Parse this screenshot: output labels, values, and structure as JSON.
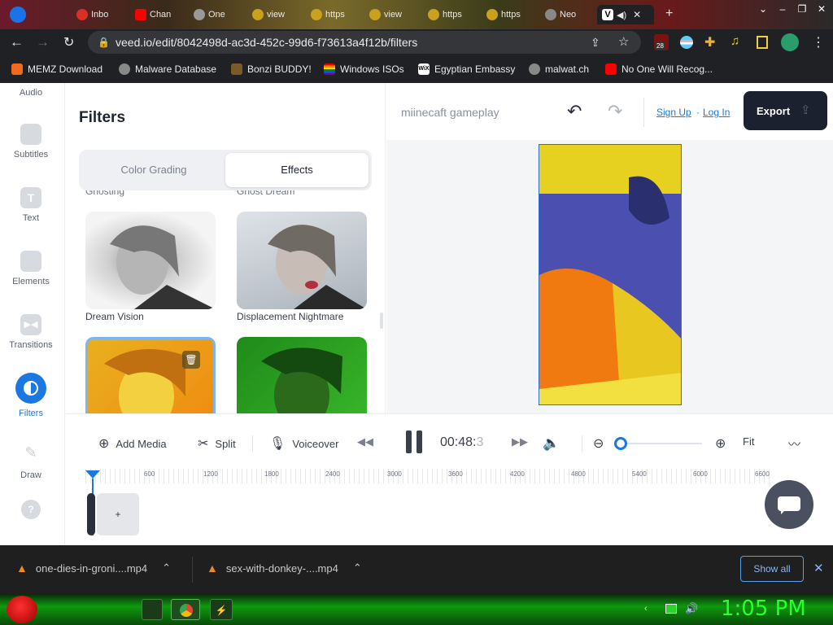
{
  "browser": {
    "tabs": [
      {
        "label": "Inbo"
      },
      {
        "label": "Chan"
      },
      {
        "label": "One"
      },
      {
        "label": "view"
      },
      {
        "label": "https"
      },
      {
        "label": "view"
      },
      {
        "label": "https"
      },
      {
        "label": "https"
      },
      {
        "label": "Neo"
      },
      {
        "label": "V"
      }
    ],
    "url": "veed.io/edit/8042498d-ac3d-452c-99d6-f73613a4f12b/filters",
    "extension_badge": "28",
    "bookmarks": [
      {
        "label": "MEMZ Download",
        "icon": "fire-icon"
      },
      {
        "label": "Malware Database",
        "icon": "globe-icon"
      },
      {
        "label": "Bonzi BUDDY!",
        "icon": "monkey-icon"
      },
      {
        "label": "Windows ISOs",
        "icon": "rainbow-flag-icon"
      },
      {
        "label": "Egyptian Embassy",
        "icon": "wix-icon"
      },
      {
        "label": "malwat.ch",
        "icon": "globe-icon"
      },
      {
        "label": "No One Will Recog...",
        "icon": "youtube-icon"
      }
    ]
  },
  "sidenav": {
    "items": [
      {
        "label": "Audio"
      },
      {
        "label": "Subtitles"
      },
      {
        "label": "Text"
      },
      {
        "label": "Elements"
      },
      {
        "label": "Transitions"
      },
      {
        "label": "Filters"
      },
      {
        "label": "Draw"
      }
    ]
  },
  "panel": {
    "title": "Filters",
    "tabs": [
      "Color Grading",
      "Effects"
    ],
    "cut_labels": [
      "Ghosting",
      "Ghost Dream"
    ],
    "filters": [
      {
        "label": "Dream Vision"
      },
      {
        "label": "Displacement Nightmare"
      }
    ]
  },
  "header": {
    "project_name": "miinecaft gameplay",
    "sign_up": "Sign Up",
    "separator": "·",
    "log_in": "Log In",
    "export_label": "Export"
  },
  "controls": {
    "add_media": "Add Media",
    "split": "Split",
    "voiceover": "Voiceover",
    "time": "00:48:",
    "time_frac": "3",
    "fit": "Fit"
  },
  "timeline": {
    "ticks": [
      "600",
      "1200",
      "1800",
      "2400",
      "3000",
      "3600",
      "4200",
      "4800",
      "5400",
      "6000",
      "6600"
    ],
    "add_label": "+"
  },
  "downloads": {
    "items": [
      {
        "label": "one-dies-in-groni....mp4"
      },
      {
        "label": "sex-with-donkey-....mp4"
      }
    ],
    "show_all": "Show all"
  },
  "taskbar": {
    "clock": "1:05 PM"
  },
  "colors": {
    "accent": "#1b78e0",
    "export_bg": "#1c2130",
    "clock": "#2bff2b"
  }
}
